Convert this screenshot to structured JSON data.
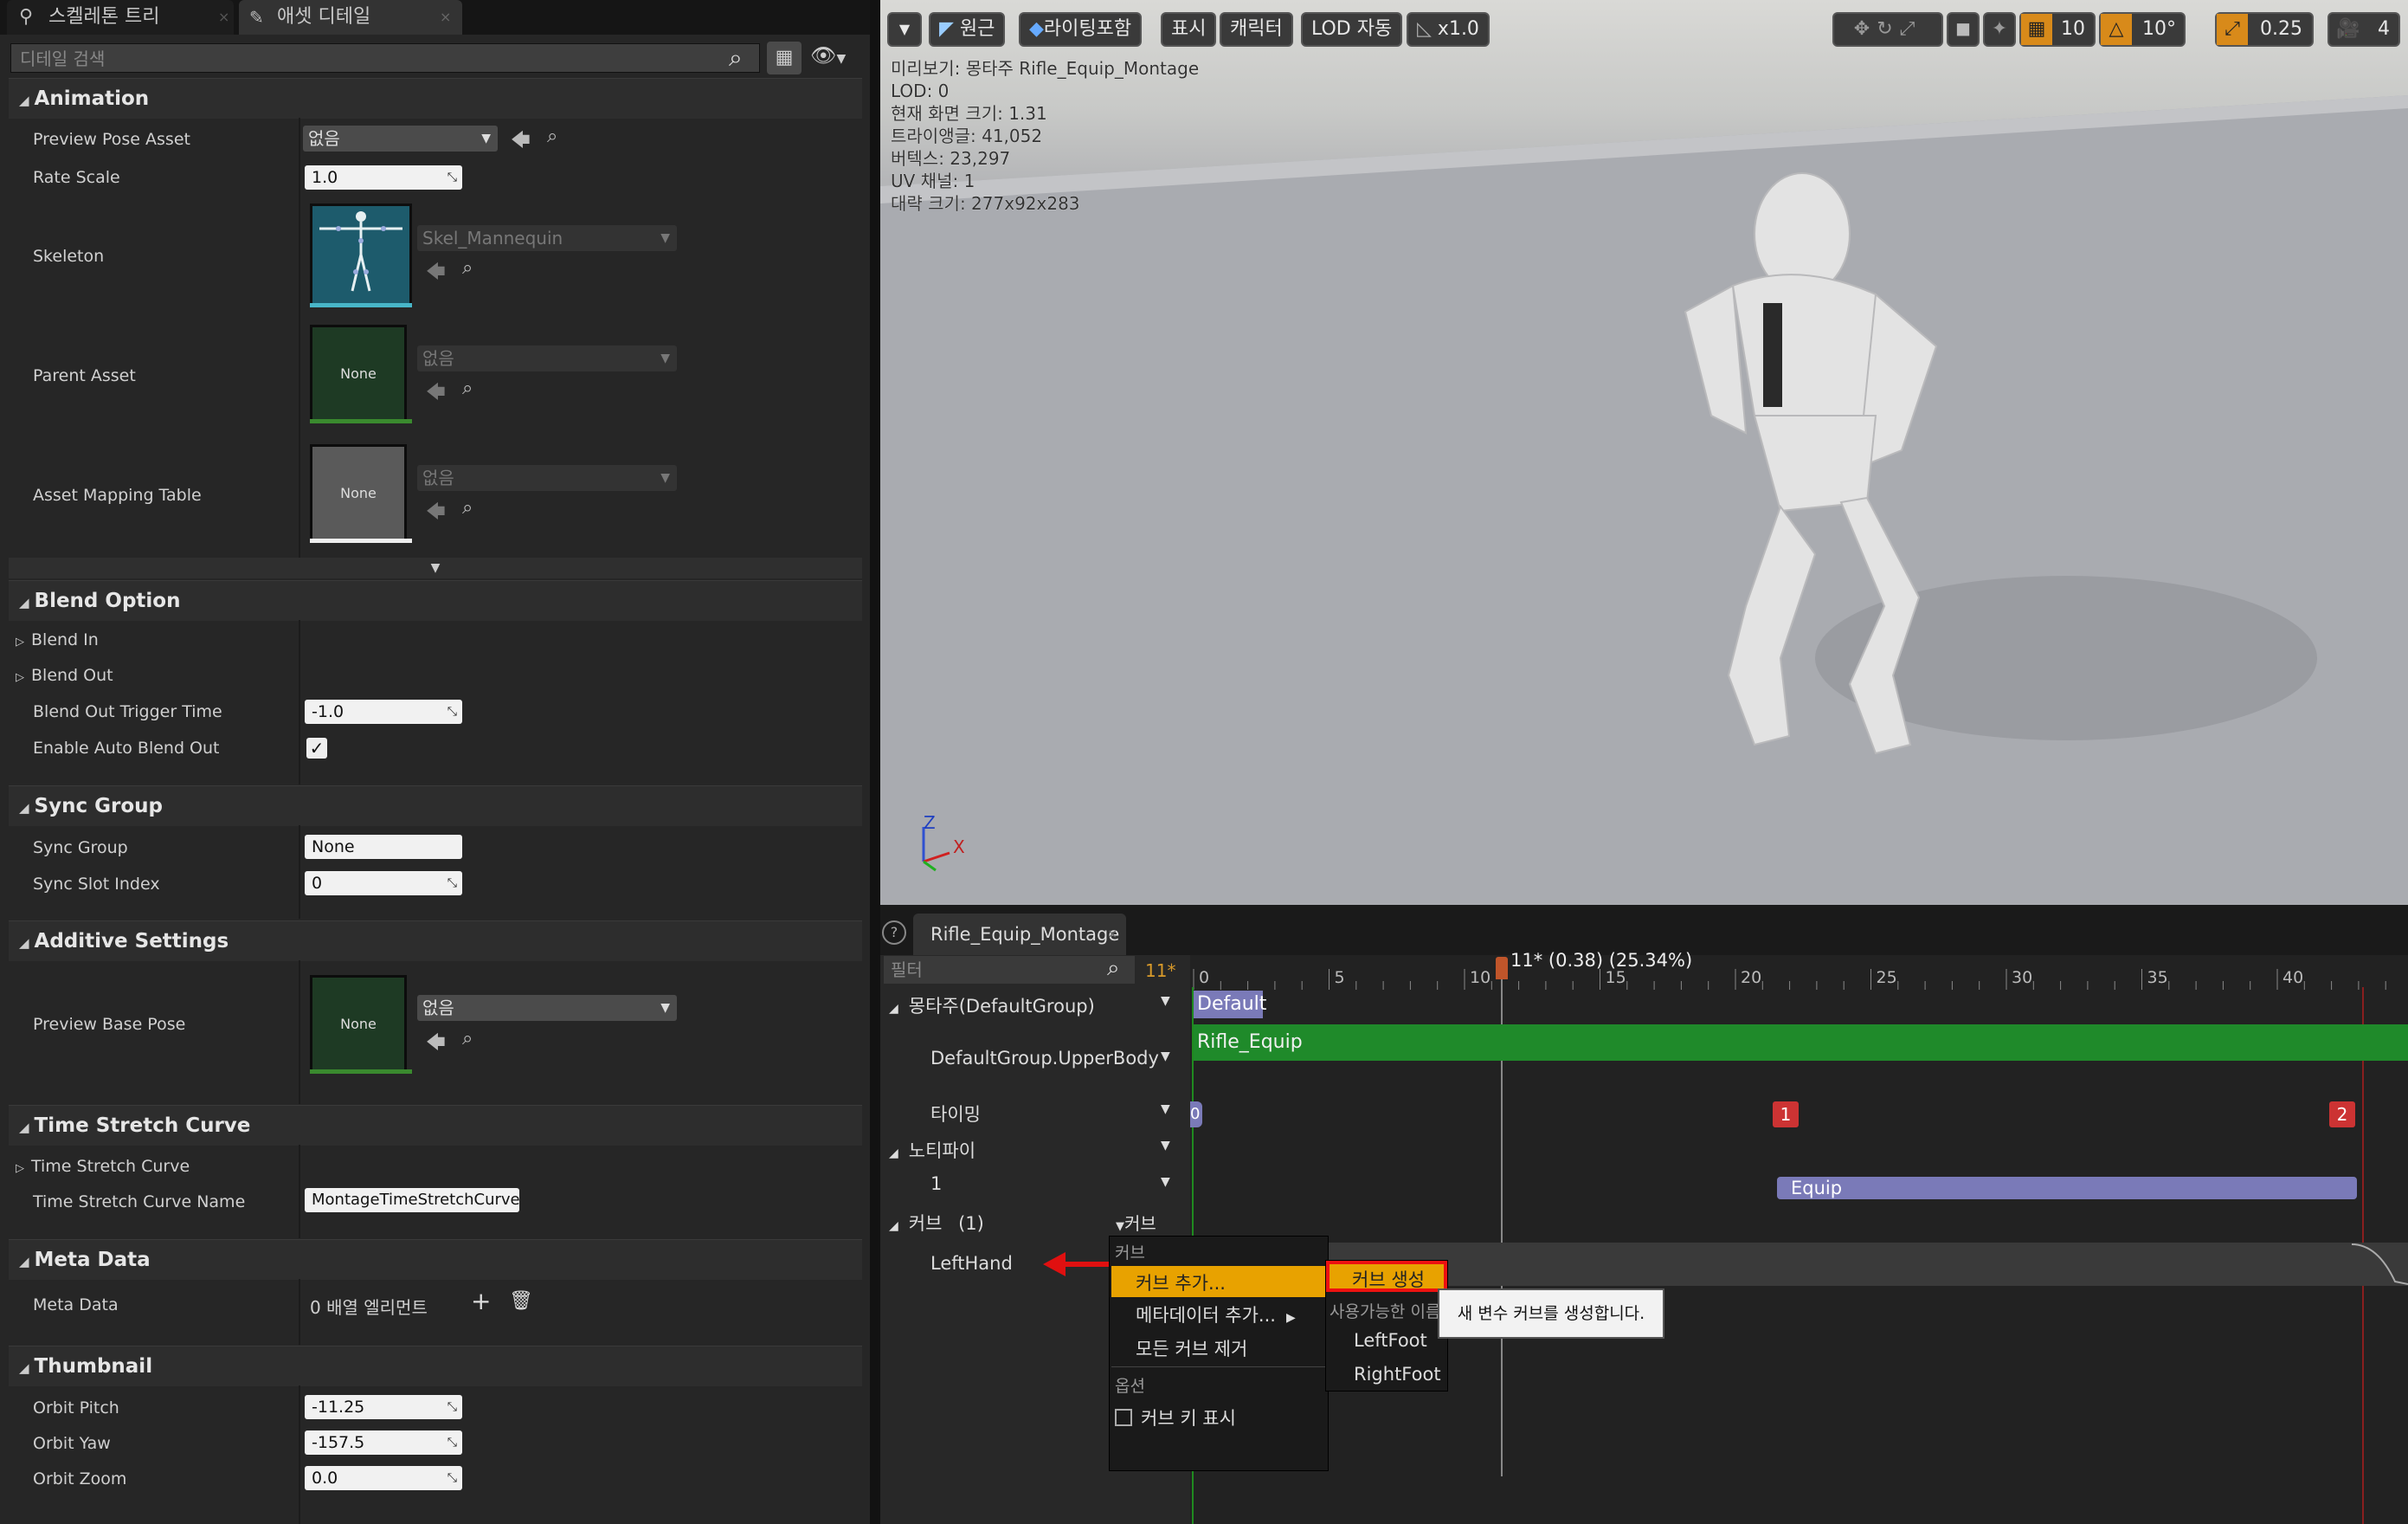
{
  "tabs": {
    "skeleton_tree": "스켈레톤 트리",
    "asset_details": "애셋 디테일"
  },
  "search": {
    "placeholder": "디테일 검색"
  },
  "sections": {
    "animation": {
      "title": "Animation",
      "preview_pose_asset": {
        "label": "Preview Pose Asset",
        "value": "없음"
      },
      "rate_scale": {
        "label": "Rate Scale",
        "value": "1.0"
      },
      "skeleton": {
        "label": "Skeleton",
        "value": "Skel_Mannequin"
      },
      "parent_asset": {
        "label": "Parent Asset",
        "value": "없음",
        "thumb": "None"
      },
      "asset_mapping_table": {
        "label": "Asset Mapping Table",
        "value": "없음",
        "thumb": "None"
      }
    },
    "blend_option": {
      "title": "Blend Option",
      "blend_in": "Blend In",
      "blend_out": "Blend Out",
      "blend_out_trigger_time": {
        "label": "Blend Out Trigger Time",
        "value": "-1.0"
      },
      "enable_auto_blend_out": {
        "label": "Enable Auto Blend Out",
        "checked": true
      }
    },
    "sync_group": {
      "title": "Sync Group",
      "sync_group": {
        "label": "Sync Group",
        "value": "None"
      },
      "sync_slot_index": {
        "label": "Sync Slot Index",
        "value": "0"
      }
    },
    "additive_settings": {
      "title": "Additive Settings",
      "preview_base_pose": {
        "label": "Preview Base Pose",
        "value": "없음",
        "thumb": "None"
      }
    },
    "time_stretch_curve": {
      "title": "Time Stretch Curve",
      "time_stretch_curve": "Time Stretch Curve",
      "curve_name": {
        "label": "Time Stretch Curve Name",
        "value": "MontageTimeStretchCurve"
      }
    },
    "meta_data": {
      "title": "Meta Data",
      "meta_data": {
        "label": "Meta Data",
        "value": "0 배열 엘리먼트"
      }
    },
    "thumbnail": {
      "title": "Thumbnail",
      "orbit_pitch": {
        "label": "Orbit Pitch",
        "value": "-11.25"
      },
      "orbit_yaw": {
        "label": "Orbit Yaw",
        "value": "-157.5"
      },
      "orbit_zoom": {
        "label": "Orbit Zoom",
        "value": "0.0"
      }
    }
  },
  "viewport": {
    "toolbar": {
      "perspective": "원근",
      "lighting": "라이팅포함",
      "show": "표시",
      "character": "캐릭터",
      "lod": "LOD 자동",
      "speed": "x1.0",
      "grid_snap": "10",
      "angle_snap": "10°",
      "scale_snap": "0.25",
      "camera_speed": "4"
    },
    "info": [
      "미리보기: 몽타주 Rifle_Equip_Montage",
      "LOD: 0",
      "현재 화면 크기: 1.31",
      "트라이앵글: 41,052",
      "버텍스: 23,297",
      "UV 채널: 1",
      "대략 크기: 277x92x283"
    ],
    "axis": {
      "z": "Z",
      "x": "X"
    }
  },
  "sequencer": {
    "tab": "Rifle_Equip_Montage",
    "filter_placeholder": "필터",
    "current_frame": "11*",
    "time_indicator": "11* (0.38) (25.34%)",
    "ruler": [
      "0",
      "5",
      "10",
      "15",
      "20",
      "25",
      "30",
      "35",
      "40"
    ],
    "tracks": {
      "montage": "몽타주(DefaultGroup)",
      "slot": "DefaultGroup.UpperBody",
      "timing": "타이밍",
      "notify": "노티파이",
      "notify_track": "1",
      "curves": "커브",
      "curves_count": "(1)",
      "curves_button": "커브",
      "left_hand": "LeftHand"
    },
    "timeline": {
      "section_default": "Default",
      "segment_rifle": "Rifle_Equip",
      "timing_start": "0",
      "timing_1": "1",
      "timing_2": "2",
      "notify_equip": "Equip"
    },
    "context_menu": {
      "header": "커브",
      "add_curve": "커브 추가...",
      "add_metadata": "메타데이터 추가...",
      "remove_all": "모든 커브 제거",
      "options_header": "옵션",
      "show_keys": "커브 키 표시"
    },
    "submenu": {
      "create_curve": "커브 생성",
      "available_header": "사용가능한 이름",
      "left_foot": "LeftFoot",
      "right_foot": "RightFoot"
    },
    "tooltip": "새 변수 커브를 생성합니다."
  }
}
